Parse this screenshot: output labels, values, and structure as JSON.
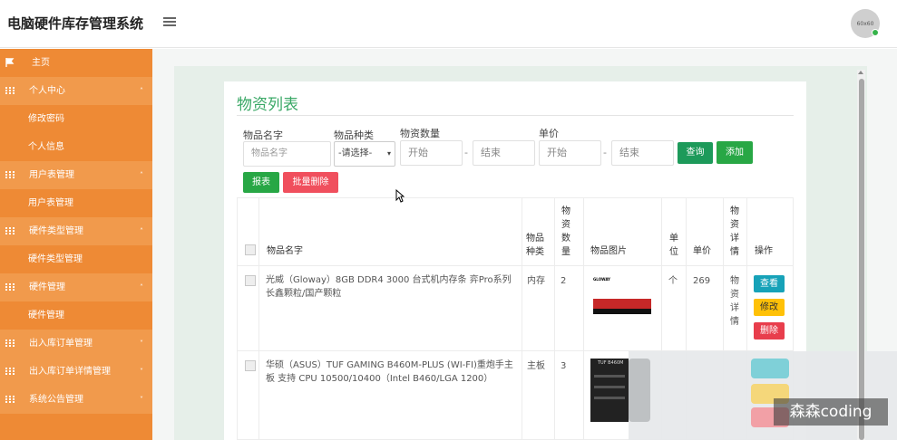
{
  "app": {
    "title": "电脑硬件库存管理系统",
    "avatar_text": "60x60"
  },
  "sidebar": {
    "home": "主页",
    "items": [
      {
        "label": "个人中心",
        "type": "parent",
        "caret": "˄"
      },
      {
        "label": "修改密码",
        "type": "child"
      },
      {
        "label": "个人信息",
        "type": "child"
      },
      {
        "label": "用户表管理",
        "type": "parent",
        "caret": "˄"
      },
      {
        "label": "用户表管理",
        "type": "child"
      },
      {
        "label": "硬件类型管理",
        "type": "parent",
        "caret": "˄"
      },
      {
        "label": "硬件类型管理",
        "type": "child"
      },
      {
        "label": "硬件管理",
        "type": "parent",
        "caret": "˄"
      },
      {
        "label": "硬件管理",
        "type": "child"
      },
      {
        "label": "出入库订单管理",
        "type": "parent",
        "caret": "˅"
      },
      {
        "label": "出入库订单详情管理",
        "type": "parent",
        "caret": "˅"
      },
      {
        "label": "系统公告管理",
        "type": "parent",
        "caret": "˅"
      }
    ]
  },
  "page": {
    "title": "物资列表"
  },
  "filters": {
    "name_label": "物品名字",
    "name_placeholder": "物品名字",
    "type_label": "物品种类",
    "type_selected": "-请选择-",
    "qty_label": "物资数量",
    "qty_start_placeholder": "开始",
    "qty_end_placeholder": "结束",
    "price_label": "单价",
    "price_start_placeholder": "开始",
    "price_end_placeholder": "结束",
    "dash": "-",
    "search_button": "查询",
    "add_button": "添加",
    "report_button": "报表",
    "batch_delete_button": "批量删除"
  },
  "table": {
    "headers": {
      "name": "物品名字",
      "type": "物品\n种类",
      "qty": "物\n资\n数\n量",
      "image": "物品图片",
      "unit": "单\n位",
      "price": "单价",
      "detail": "物\n资\n详\n情",
      "actions": "操作"
    },
    "rows": [
      {
        "name": "光威（Gloway）8GB DDR4 3000 台式机内存条 弈Pro系列 长鑫颗粒/国产颗粒",
        "type": "内存",
        "qty": "2",
        "unit": "个",
        "price": "269",
        "detail": "物\n资\n详\n情",
        "image_caption": "GLOWAY"
      },
      {
        "name": "华硕（ASUS）TUF GAMING B460M-PLUS (WI-FI)重炮手主板 支持 CPU 10500/10400（Intel B460/LGA 1200）",
        "type": "主板",
        "qty": "3",
        "unit": "",
        "price": "",
        "detail": "",
        "image_caption": "TUF B460M"
      }
    ],
    "row_actions": {
      "view": "查看",
      "edit": "修改",
      "delete": "删除"
    }
  },
  "watermark": "森森coding"
}
